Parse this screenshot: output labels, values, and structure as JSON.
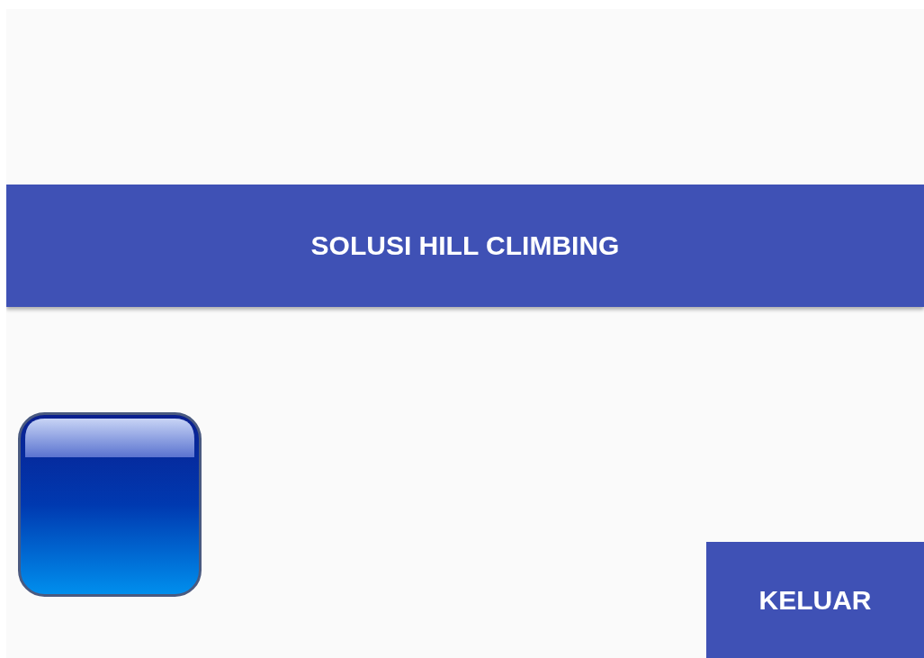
{
  "title_bar": {
    "title": "SOLUSI HILL CLIMBING"
  },
  "buttons": [
    {
      "label": "KELUAR"
    }
  ]
}
